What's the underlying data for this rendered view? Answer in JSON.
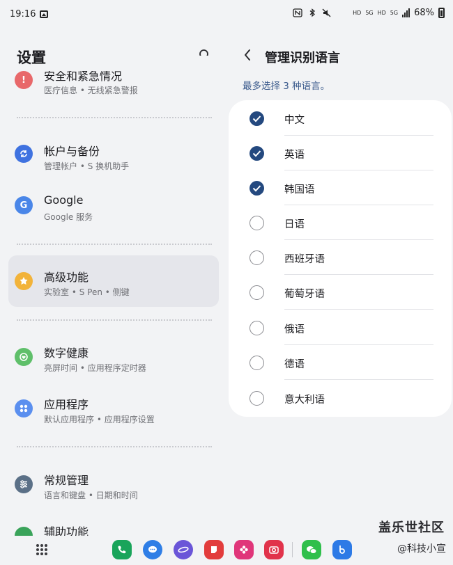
{
  "status_bar": {
    "time": "19:16",
    "icons": [
      "gallery-icon",
      "nfc-icon",
      "bluetooth-icon",
      "mute-icon",
      "hd-icon",
      "5g-icon",
      "signal-icon"
    ],
    "net1": "HD",
    "net1b": "5G",
    "net2": "HD",
    "net2b": "5G",
    "battery": "68%"
  },
  "left": {
    "title": "设置",
    "items": [
      {
        "title": "安全和紧急情况",
        "subtitle": "医疗信息 • 无线紧急警报",
        "icon": "alert-icon",
        "color": "#e8686a"
      },
      {
        "title": "帐户与备份",
        "subtitle": "管理帐户 • S 换机助手",
        "icon": "sync-icon",
        "color": "#3f72e0"
      },
      {
        "title": "Google",
        "subtitle": "Google 服务",
        "icon": "google-icon",
        "color": "#4a86e8"
      },
      {
        "title": "高级功能",
        "subtitle": "实验室 • S Pen • 侧键",
        "icon": "advanced-icon",
        "color": "#f2b33a"
      },
      {
        "title": "数字健康",
        "subtitle": "亮屏时间 • 应用程序定时器",
        "icon": "wellbeing-icon",
        "color": "#5fbf6a"
      },
      {
        "title": "应用程序",
        "subtitle": "默认应用程序 • 应用程序设置",
        "icon": "apps-icon",
        "color": "#5b8fef"
      },
      {
        "title": "常规管理",
        "subtitle": "语言和键盘 • 日期和时间",
        "icon": "sliders-icon",
        "color": "#5b7087"
      },
      {
        "title": "辅助功能",
        "subtitle": "",
        "icon": "accessibility-icon",
        "color": "#3aa35a"
      }
    ]
  },
  "right": {
    "title": "管理识别语言",
    "hint": "最多选择 3 种语言。",
    "languages": [
      {
        "label": "中文",
        "checked": true
      },
      {
        "label": "英语",
        "checked": true
      },
      {
        "label": "韩国语",
        "checked": true
      },
      {
        "label": "日语",
        "checked": false
      },
      {
        "label": "西班牙语",
        "checked": false
      },
      {
        "label": "葡萄牙语",
        "checked": false
      },
      {
        "label": "俄语",
        "checked": false
      },
      {
        "label": "德语",
        "checked": false
      },
      {
        "label": "意大利语",
        "checked": false
      }
    ]
  },
  "dock": {
    "apps": [
      {
        "name": "phone-app",
        "color": "#19a45a"
      },
      {
        "name": "messages-app",
        "color": "#2f7ee6"
      },
      {
        "name": "internet-app",
        "color": "#6a55d8"
      },
      {
        "name": "notes-app",
        "color": "#e23c3c"
      },
      {
        "name": "flower-app",
        "color": "#e0367a"
      },
      {
        "name": "camera-app",
        "color": "#e1334b"
      },
      {
        "name": "wechat-app",
        "color": "#2fbf4b"
      },
      {
        "name": "bixby-app",
        "color": "#2d7ae6"
      }
    ]
  },
  "watermark": {
    "line1": "盖乐世社区",
    "line2": "@科技小宣"
  }
}
